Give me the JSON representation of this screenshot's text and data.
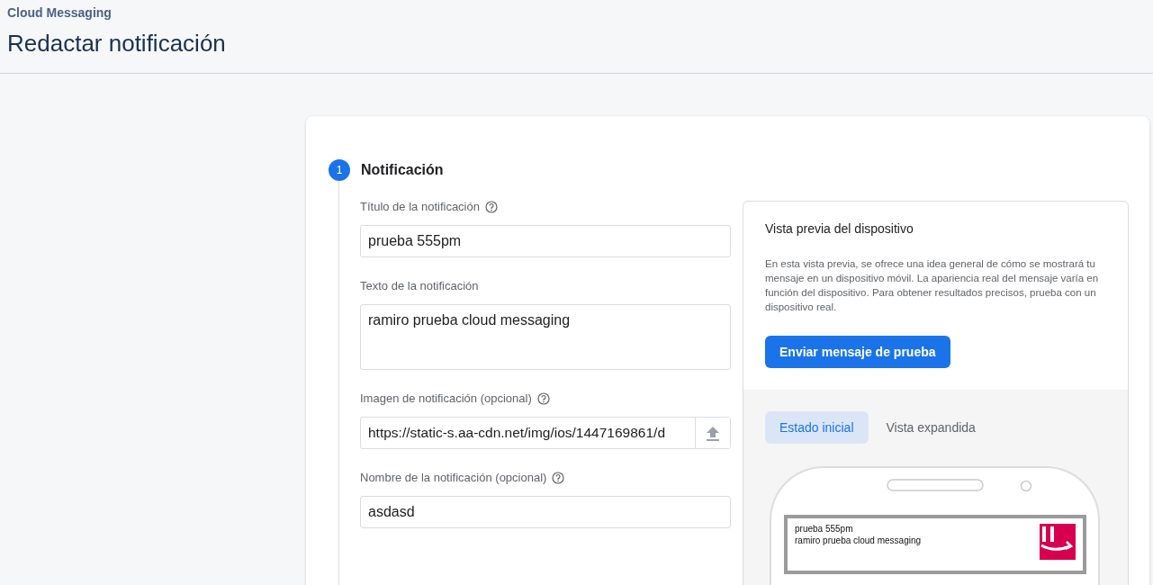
{
  "header": {
    "breadcrumb": "Cloud Messaging",
    "title": "Redactar notificación"
  },
  "step": {
    "number": "1",
    "title": "Notificación"
  },
  "fields": [
    {
      "kind": "text",
      "label": "Título de la notificación",
      "help": true,
      "value": "prueba 555pm"
    },
    {
      "kind": "textarea",
      "label": "Texto de la notificación",
      "help": false,
      "value": "ramiro prueba cloud messaging"
    },
    {
      "kind": "upload",
      "label": "Imagen de notificación (opcional)",
      "help": true,
      "value": "https://static-s.aa-cdn.net/img/ios/1447169861/d"
    },
    {
      "kind": "text",
      "label": "Nombre de la notificación (opcional)",
      "help": true,
      "value": "asdasd"
    }
  ],
  "preview": {
    "title": "Vista previa del dispositivo",
    "description": "En esta vista previa, se ofrece una idea general de cómo se mostrará tu mensaje en un dispositivo móvil. La apariencia real del mensaje varía en función del dispositivo. Para obtener resultados precisos, prueba con un dispositivo real.",
    "button": "Enviar mensaje de prueba",
    "tabs": [
      {
        "label": "Estado inicial",
        "selected": true
      },
      {
        "label": "Vista expandida",
        "selected": false
      }
    ],
    "notification": {
      "title": "prueba 555pm",
      "text": "ramiro prueba cloud messaging"
    }
  }
}
